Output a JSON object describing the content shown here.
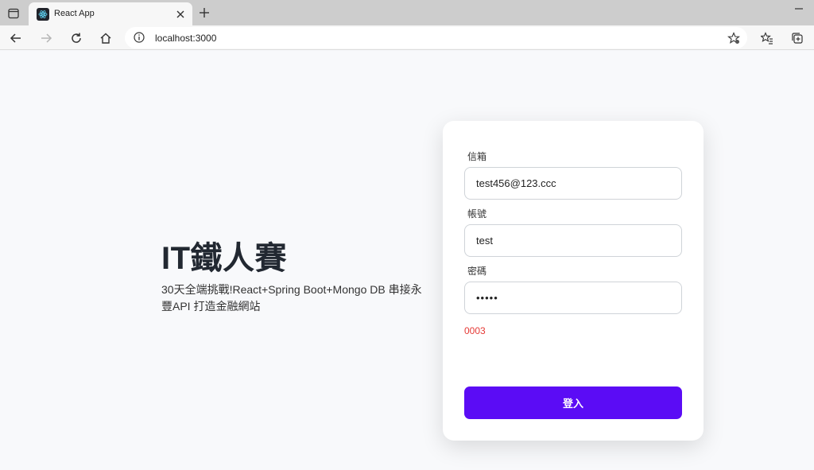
{
  "browser": {
    "tab_title": "React App",
    "url": "localhost:3000"
  },
  "hero": {
    "title": "IT鐵人賽",
    "description": "30天全端挑戰!React+Spring Boot+Mongo DB 串接永豐API 打造金融網站"
  },
  "form": {
    "email_label": "信箱",
    "email_value": "test456@123.ccc",
    "account_label": "帳號",
    "account_value": "test",
    "password_label": "密碼",
    "password_value": "•••••",
    "error_message": "0003",
    "submit_label": "登入"
  },
  "colors": {
    "primary": "#5b0cf5",
    "error": "#e53935",
    "page_bg": "#f8f9fb"
  }
}
